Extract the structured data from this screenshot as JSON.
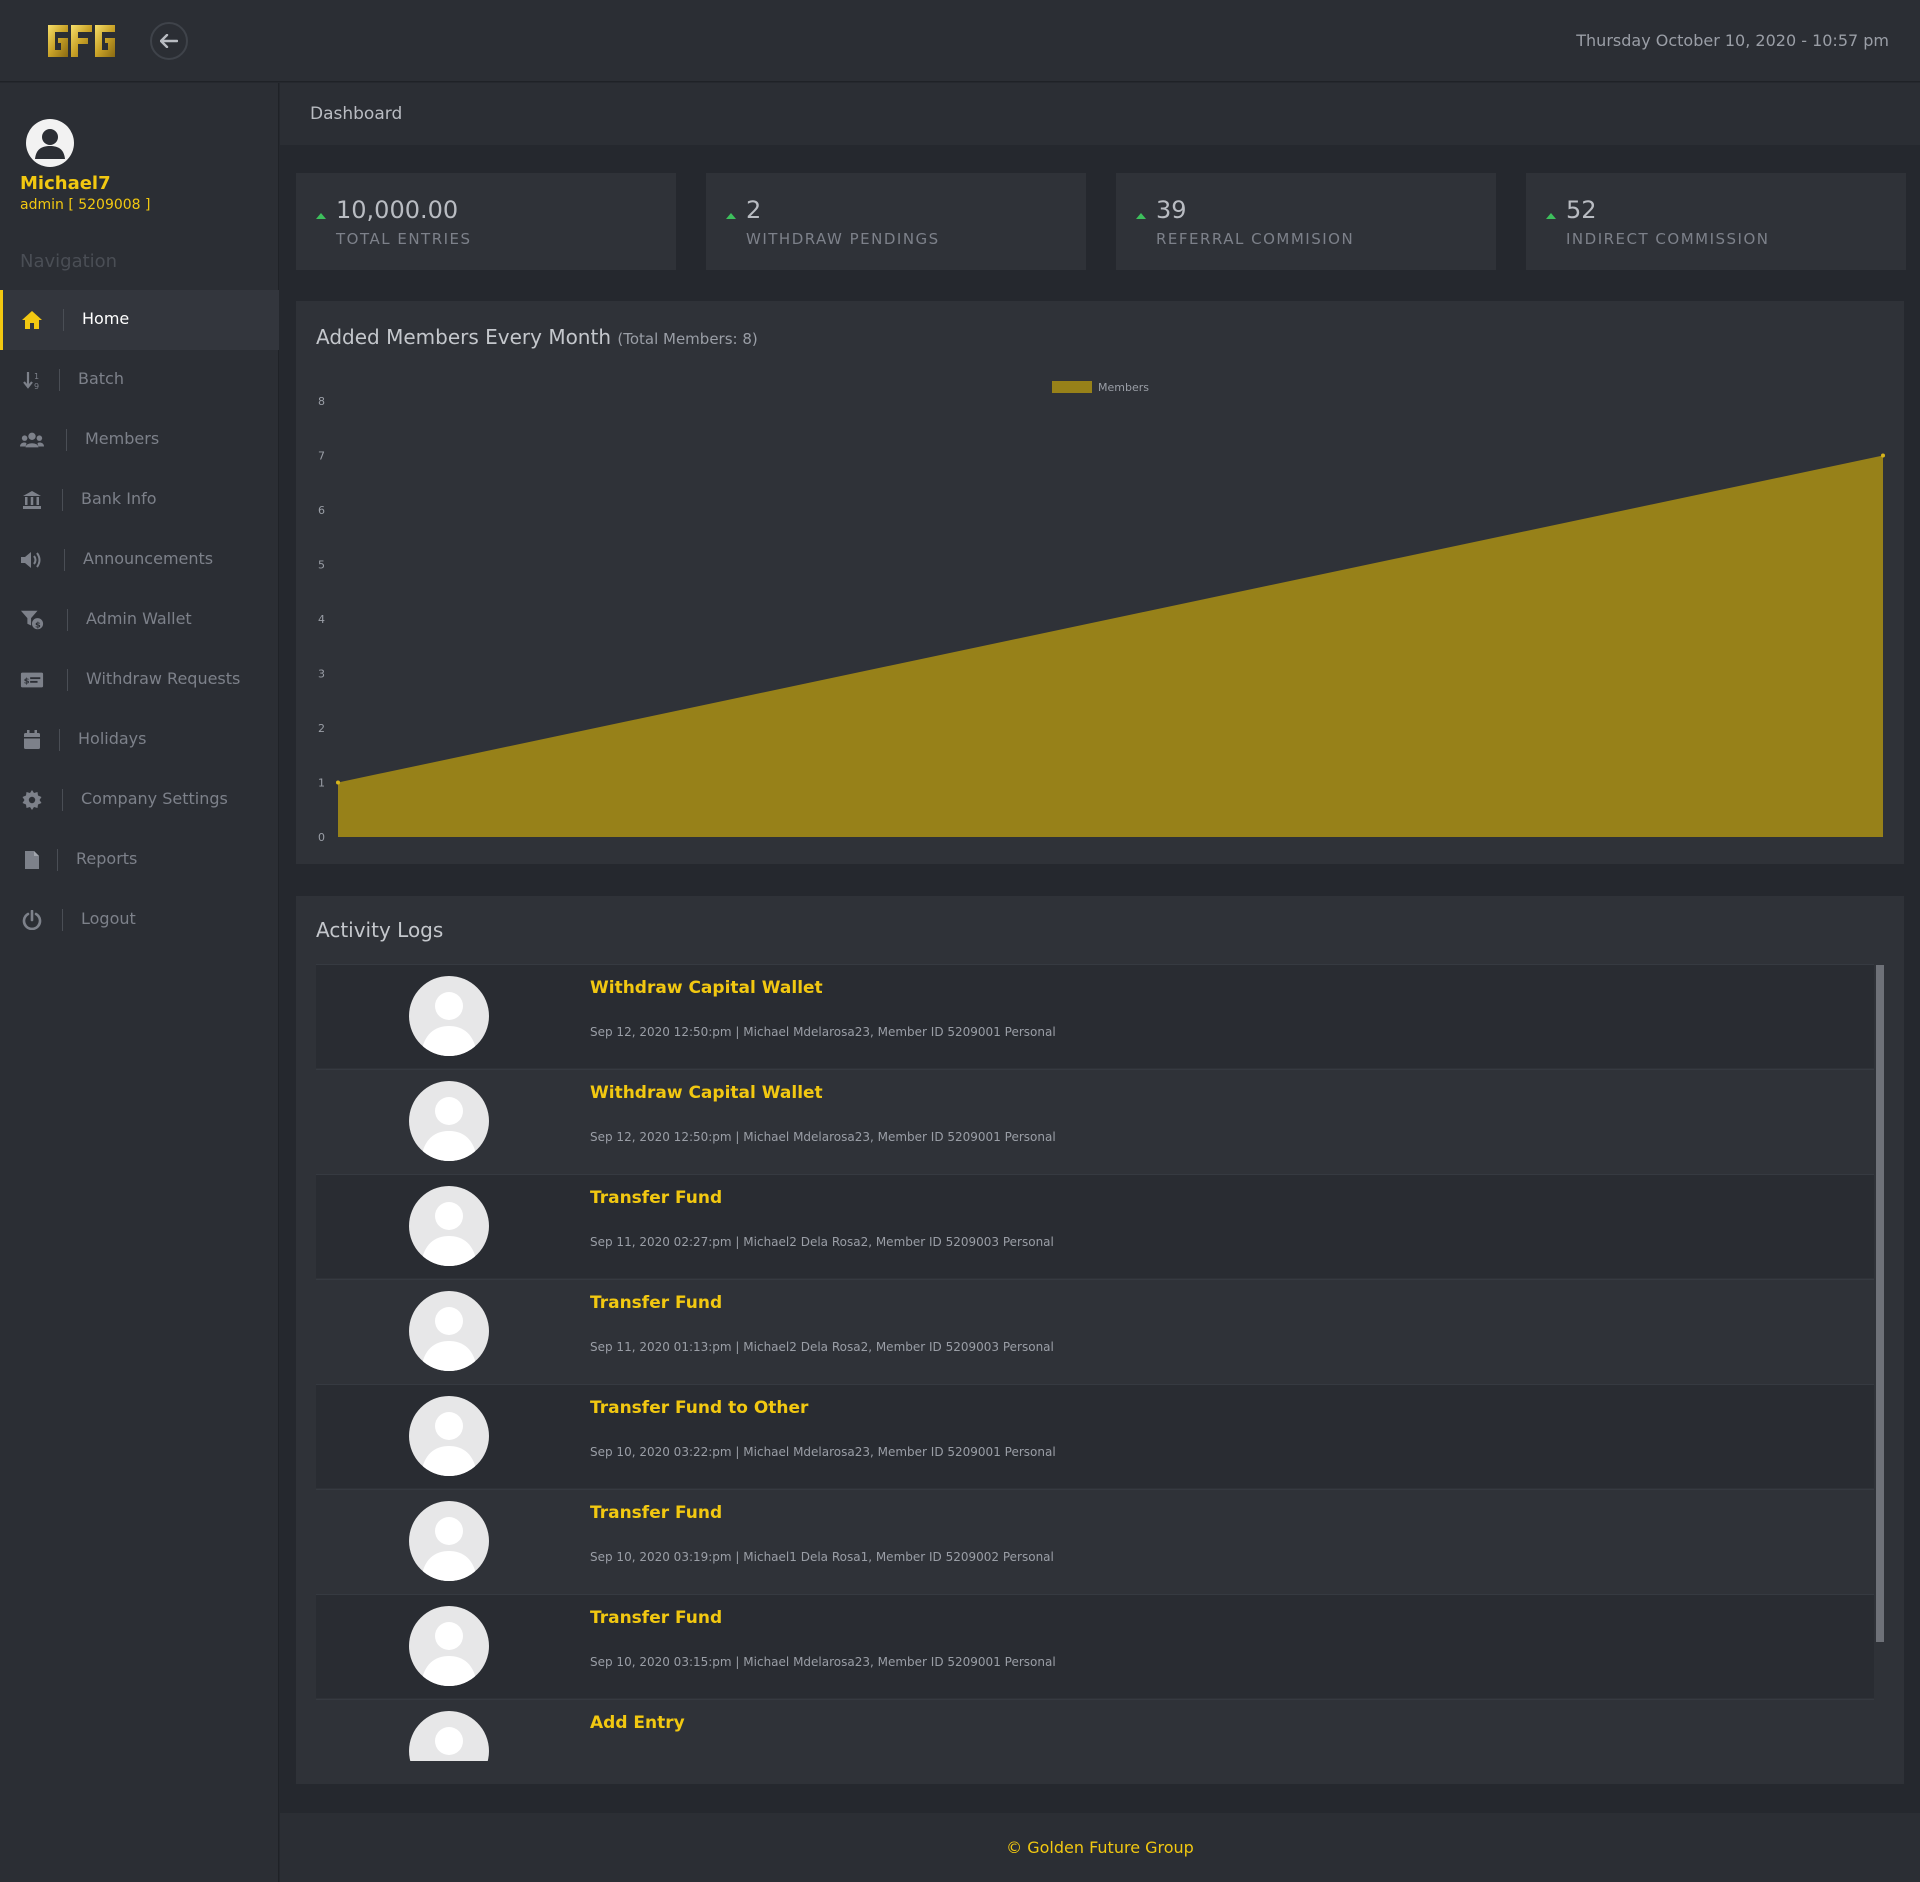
{
  "topbar": {
    "logo_text": "GFG",
    "datetime": "Thursday October 10, 2020 - 10:57 pm"
  },
  "user": {
    "name": "Michael7",
    "role": "admin [ 5209008 ]"
  },
  "sidebar": {
    "title": "Navigation",
    "items": [
      {
        "label": "Home",
        "icon": "home-icon"
      },
      {
        "label": "Batch",
        "icon": "sort-icon"
      },
      {
        "label": "Members",
        "icon": "users-icon"
      },
      {
        "label": "Bank Info",
        "icon": "bank-icon"
      },
      {
        "label": "Announcements",
        "icon": "megaphone-icon"
      },
      {
        "label": "Admin Wallet",
        "icon": "funnel-dollar-icon"
      },
      {
        "label": "Withdraw Requests",
        "icon": "money-card-icon"
      },
      {
        "label": "Holidays",
        "icon": "calendar-icon"
      },
      {
        "label": "Company Settings",
        "icon": "gear-icon"
      },
      {
        "label": "Reports",
        "icon": "file-icon"
      },
      {
        "label": "Logout",
        "icon": "power-icon"
      }
    ]
  },
  "page": {
    "breadcrumb": "Dashboard"
  },
  "stats": [
    {
      "value": "10,000.00",
      "label": "TOTAL ENTRIES"
    },
    {
      "value": "2",
      "label": "WITHDRAW PENDINGS"
    },
    {
      "value": "39",
      "label": "REFERRAL COMMISION"
    },
    {
      "value": "52",
      "label": "INDIRECT COMMISSION"
    }
  ],
  "chart_panel": {
    "title": "Added Members Every Month",
    "subtitle": "(Total Members: 8)"
  },
  "chart_data": {
    "type": "area",
    "title": "Added Members Every Month",
    "x": [
      0,
      1
    ],
    "series": [
      {
        "name": "Members",
        "values": [
          1,
          7
        ],
        "color": "#978119"
      }
    ],
    "ylim": [
      0,
      8
    ],
    "yticks": [
      "0",
      "1",
      "2",
      "3",
      "4",
      "5",
      "6",
      "7",
      "8"
    ],
    "legend_position": "top-center",
    "grid": false
  },
  "activity": {
    "title": "Activity Logs",
    "items": [
      {
        "title": "Withdraw Capital Wallet",
        "meta": "Sep 12, 2020 12:50:pm | Michael Mdelarosa23, Member ID 5209001 Personal"
      },
      {
        "title": "Withdraw Capital Wallet",
        "meta": "Sep 12, 2020 12:50:pm | Michael Mdelarosa23, Member ID 5209001 Personal"
      },
      {
        "title": "Transfer Fund",
        "meta": "Sep 11, 2020 02:27:pm | Michael2 Dela Rosa2, Member ID 5209003 Personal"
      },
      {
        "title": "Transfer Fund",
        "meta": "Sep 11, 2020 01:13:pm | Michael2 Dela Rosa2, Member ID 5209003 Personal"
      },
      {
        "title": "Transfer Fund to Other",
        "meta": "Sep 10, 2020 03:22:pm | Michael Mdelarosa23, Member ID 5209001 Personal"
      },
      {
        "title": "Transfer Fund",
        "meta": "Sep 10, 2020 03:19:pm | Michael1 Dela Rosa1, Member ID 5209002 Personal"
      },
      {
        "title": "Transfer Fund",
        "meta": "Sep 10, 2020 03:15:pm | Michael Mdelarosa23, Member ID 5209001 Personal"
      },
      {
        "title": "Add Entry",
        "meta": ""
      }
    ]
  },
  "footer": {
    "text": "© Golden Future Group"
  },
  "colors": {
    "accent": "#f2c811",
    "chart_fill": "#978119",
    "positive": "#3dbf5c"
  }
}
